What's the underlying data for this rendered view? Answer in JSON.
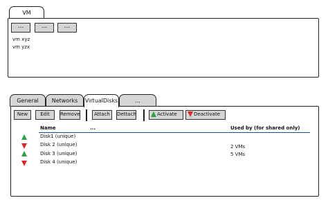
{
  "vm_panel": {
    "tab_label": "VM",
    "buttons": [
      "...",
      "...",
      "..."
    ],
    "list": [
      "vm xyz",
      "vm yzx"
    ]
  },
  "detail_panel": {
    "tabs": [
      "General",
      "Networks",
      "VirtualDisks",
      "..."
    ],
    "active_tab": "VirtualDisks",
    "toolbar": {
      "new_label": "New",
      "edit_label": "Edit",
      "remove_label": "Remove",
      "attach_label": "Attach",
      "dettach_label": "Dettach",
      "activate_label": "Activate",
      "deactivate_label": "Deactivate"
    },
    "table": {
      "col_name": "Name",
      "col_more": "...",
      "col_used": "Used by (for shared only)",
      "rows": [
        {
          "status": "active",
          "name": "Disk1 (unique)",
          "used_by": ""
        },
        {
          "status": "inactive",
          "name": "Disk 2 (unique)",
          "used_by": "2 VMs"
        },
        {
          "status": "active",
          "name": "Disk 3 (unique)",
          "used_by": "5 VMs"
        },
        {
          "status": "inactive",
          "name": "Disk 4 (unique)",
          "used_by": ""
        }
      ]
    }
  },
  "colors": {
    "active_icon": "#2ea043",
    "inactive_icon": "#d62a2a",
    "button_bg": "#d4d4d4",
    "header_rule": "#1b4f8a"
  }
}
